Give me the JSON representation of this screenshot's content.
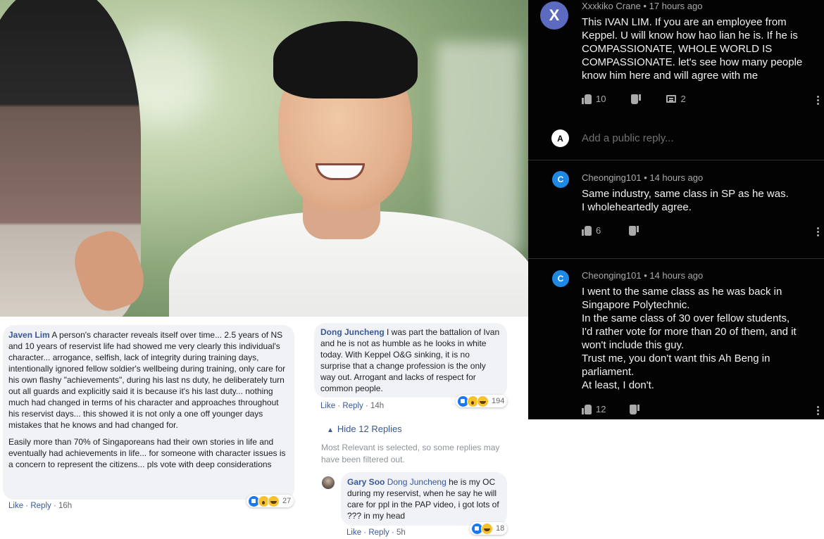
{
  "youtube": {
    "comments": [
      {
        "avatar_letter": "X",
        "avatar_color": "#5c6bc0",
        "author": "Xxxkiko Crane",
        "time": "17 hours ago",
        "text": "This IVAN LIM. If you are an employee from Keppel. U will know how hao lian he is. If he is COMPASSIONATE, WHOLE WORLD IS COMPASSIONATE. let's see how many people know him here and will agree with me",
        "likes": "10",
        "replies": "2"
      },
      {
        "avatar_letter": "C",
        "avatar_color": "#1e88e5",
        "author": "Cheonging101",
        "time": "14 hours ago",
        "text_lines": [
          "Same industry, same class in SP as he was.",
          "I wholeheartedly agree."
        ],
        "likes": "6"
      },
      {
        "avatar_letter": "C",
        "avatar_color": "#1e88e5",
        "author": "Cheonging101",
        "time": "14 hours ago",
        "text_lines": [
          "I went to the same class as he was back in",
          "Singapore Polytechnic.",
          "In the same class of 30 over fellow students,",
          "I'd rather vote for more than 20 of them, and it",
          "won't include this guy.",
          "Trust me, you don't want this Ah Beng in",
          "parliament.",
          "At least, I don't."
        ],
        "likes": "12"
      }
    ],
    "reply_placeholder": "Add a public reply...",
    "reply_avatar_text": "A"
  },
  "facebook": {
    "javen": {
      "name": "Javen Lim",
      "text": "A person's character reveals itself over time... 2.5 years of NS and 10 years of reservist life had showed me very clearly this individual's character... arrogance, selfish, lack of integrity during training days, intentionally ignored fellow soldier's wellbeing during training, only care for his own flashy \"achievements\", during his last ns duty, he deliberately turn out all guards and explicitly said it is because it's his last duty... nothing much had changed in terms of his character and approaches throughout his reservist days... this showed it is not only a one off younger days mistakes that he knows and had changed for.",
      "text2": "Easily more than 70% of Singaporeans had their own stories in life and eventually had achievements in life... for someone with character issues is a concern to represent the citizens... pls vote with deep considerations",
      "like": "Like",
      "reply": "Reply",
      "time": "16h",
      "reactions": "27"
    },
    "dong": {
      "name": "Dong Juncheng",
      "text": "I was part the battalion of Ivan and he is not as humble as he looks in white today. With Keppel O&G sinking, it is no surprise that a change profession is the only way out. Arrogant and lacks of respect for common people.",
      "like": "Like",
      "reply": "Reply",
      "time": "14h",
      "reactions": "194"
    },
    "hide_replies": "Hide 12 Replies",
    "filter_note": "Most Relevant is selected, so some replies may have been filtered out.",
    "gary": {
      "name": "Gary Soo",
      "mention": "Dong Juncheng",
      "text": "he is my OC during my reservist, when he say he will care for ppl in the PAP video, i got lots of ??? in my head",
      "like": "Like",
      "reply": "Reply",
      "time": "5h",
      "reactions": "18"
    }
  }
}
